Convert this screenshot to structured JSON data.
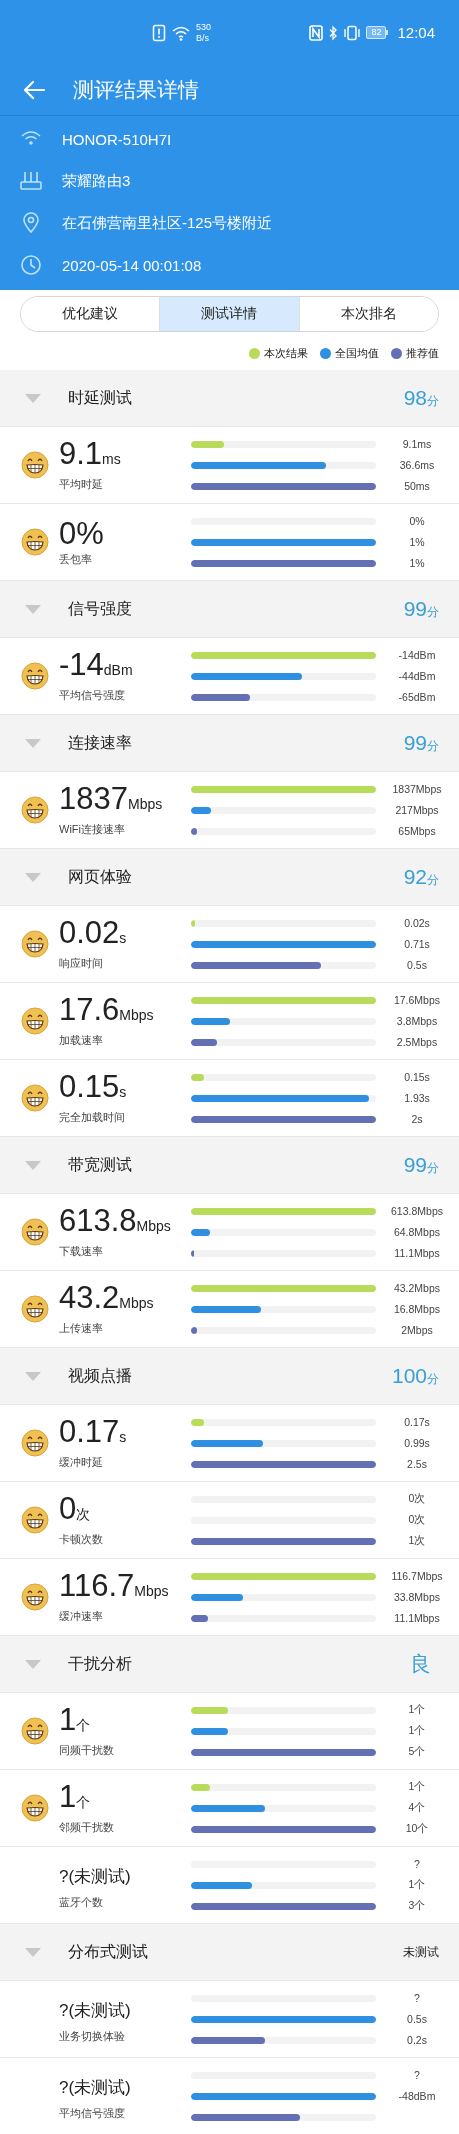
{
  "status_bar": {
    "net_speed": "530",
    "net_unit": "B/s",
    "battery": "82",
    "time": "12:04"
  },
  "title_bar": {
    "title": "测评结果详情"
  },
  "info": [
    {
      "kind": "wifi",
      "text": "HONOR-510H7I"
    },
    {
      "kind": "router",
      "text": "荣耀路由3"
    },
    {
      "kind": "location",
      "text": "在石佛营南里社区-125号楼附近"
    },
    {
      "kind": "time",
      "text": "2020-05-14 00:01:08"
    }
  ],
  "tabs": [
    {
      "label": "优化建议",
      "selected": false
    },
    {
      "label": "测试详情",
      "selected": true
    },
    {
      "label": "本次排名",
      "selected": false
    }
  ],
  "legend": [
    {
      "label": "本次结果",
      "color": "#b8dc5a"
    },
    {
      "label": "全国均值",
      "color": "#2f8fe0"
    },
    {
      "label": "推荐值",
      "color": "#6470b4"
    }
  ],
  "sections": [
    {
      "title": "时延测试",
      "tested": true,
      "score": "98",
      "score_unit": "分",
      "rows": [
        {
          "kind": "measured",
          "value": "9.1",
          "unit": "ms",
          "label": "平均时延",
          "bars": [
            {
              "level": 0.18,
              "reading": "9.1ms"
            },
            {
              "level": 0.73,
              "reading": "36.6ms"
            },
            {
              "level": 1,
              "reading": "50ms"
            }
          ]
        },
        {
          "kind": "measured",
          "value": "0%",
          "label": "丢包率",
          "bars": [
            {
              "reading": "0%"
            },
            {
              "level": 1,
              "reading": "1%"
            },
            {
              "level": 1,
              "reading": "1%"
            }
          ]
        }
      ]
    },
    {
      "title": "信号强度",
      "tested": true,
      "score": "99",
      "score_unit": "分",
      "rows": [
        {
          "kind": "measured",
          "value": "-14",
          "unit": "dBm",
          "label": "平均信号强度",
          "bars": [
            {
              "level": 1,
              "reading": "-14dBm"
            },
            {
              "level": 0.6,
              "reading": "-44dBm"
            },
            {
              "level": 0.32,
              "reading": "-65dBm"
            }
          ]
        }
      ]
    },
    {
      "title": "连接速率",
      "tested": true,
      "score": "99",
      "score_unit": "分",
      "rows": [
        {
          "kind": "measured",
          "value": "1837",
          "unit": "Mbps",
          "label": "WiFi连接速率",
          "bars": [
            {
              "level": 1,
              "reading": "1837Mbps"
            },
            {
              "level": 0.11,
              "reading": "217Mbps"
            },
            {
              "level": 0.03,
              "reading": "65Mbps"
            }
          ]
        }
      ]
    },
    {
      "title": "网页体验",
      "tested": true,
      "score": "92",
      "score_unit": "分",
      "rows": [
        {
          "kind": "measured",
          "value": "0.02",
          "unit": "s",
          "label": "响应时间",
          "bars": [
            {
              "level": 0.02,
              "reading": "0.02s"
            },
            {
              "level": 1,
              "reading": "0.71s"
            },
            {
              "level": 0.7,
              "reading": "0.5s"
            }
          ]
        },
        {
          "kind": "measured",
          "value": "17.6",
          "unit": "Mbps",
          "label": "加载速率",
          "bars": [
            {
              "level": 1,
              "reading": "17.6Mbps"
            },
            {
              "level": 0.21,
              "reading": "3.8Mbps"
            },
            {
              "level": 0.14,
              "reading": "2.5Mbps"
            }
          ]
        },
        {
          "kind": "measured",
          "value": "0.15",
          "unit": "s",
          "label": "完全加载时间",
          "bars": [
            {
              "level": 0.07,
              "reading": "0.15s"
            },
            {
              "level": 0.96,
              "reading": "1.93s"
            },
            {
              "level": 1,
              "reading": "2s"
            }
          ]
        }
      ]
    },
    {
      "title": "带宽测试",
      "tested": true,
      "score": "99",
      "score_unit": "分",
      "rows": [
        {
          "kind": "measured",
          "value": "613.8",
          "unit": "Mbps",
          "label": "下载速率",
          "bars": [
            {
              "level": 1,
              "reading": "613.8Mbps"
            },
            {
              "level": 0.1,
              "reading": "64.8Mbps"
            },
            {
              "level": 0.01,
              "reading": "11.1Mbps"
            }
          ]
        },
        {
          "kind": "measured",
          "value": "43.2",
          "unit": "Mbps",
          "label": "上传速率",
          "bars": [
            {
              "level": 1,
              "reading": "43.2Mbps"
            },
            {
              "level": 0.38,
              "reading": "16.8Mbps"
            },
            {
              "level": 0.03,
              "reading": "2Mbps"
            }
          ]
        }
      ]
    },
    {
      "title": "视频点播",
      "tested": true,
      "score": "100",
      "score_unit": "分",
      "rows": [
        {
          "kind": "measured",
          "value": "0.17",
          "unit": "s",
          "label": "缓冲时延",
          "bars": [
            {
              "level": 0.07,
              "reading": "0.17s"
            },
            {
              "level": 0.39,
              "reading": "0.99s"
            },
            {
              "level": 1,
              "reading": "2.5s"
            }
          ]
        },
        {
          "kind": "measured",
          "value": "0",
          "unit": "次",
          "label": "卡顿次数",
          "bars": [
            {
              "reading": "0次"
            },
            {
              "reading": "0次"
            },
            {
              "level": 1,
              "reading": "1次"
            }
          ]
        },
        {
          "kind": "measured",
          "value": "116.7",
          "unit": "Mbps",
          "label": "缓冲速率",
          "bars": [
            {
              "level": 1,
              "reading": "116.7Mbps"
            },
            {
              "level": 0.28,
              "reading": "33.8Mbps"
            },
            {
              "level": 0.09,
              "reading": "11.1Mbps"
            }
          ]
        }
      ]
    },
    {
      "title": "干扰分析",
      "tested": true,
      "score": "良",
      "rows": [
        {
          "kind": "measured",
          "value": "1",
          "unit": "个",
          "label": "同频干扰数",
          "bars": [
            {
              "level": 0.2,
              "reading": "1个"
            },
            {
              "level": 0.2,
              "reading": "1个"
            },
            {
              "level": 1,
              "reading": "5个"
            }
          ]
        },
        {
          "kind": "measured",
          "value": "1",
          "unit": "个",
          "label": "邻频干扰数",
          "bars": [
            {
              "level": 0.1,
              "reading": "1个"
            },
            {
              "level": 0.4,
              "reading": "4个"
            },
            {
              "level": 1,
              "reading": "10个"
            }
          ]
        },
        {
          "kind": "untested",
          "value": "?(未测试)",
          "label": "蓝牙个数",
          "bars": [
            {
              "reading": "?"
            },
            {
              "level": 0.33,
              "reading": "1个"
            },
            {
              "level": 1,
              "reading": "3个"
            }
          ]
        }
      ]
    },
    {
      "title": "分布式测试",
      "tested": false,
      "score": "未测试",
      "rows": [
        {
          "kind": "untested",
          "value": "?(未测试)",
          "label": "业务切换体验",
          "bars": [
            {
              "reading": "?"
            },
            {
              "level": 1,
              "reading": "0.5s"
            },
            {
              "level": 0.4,
              "reading": "0.2s"
            }
          ]
        },
        {
          "kind": "untested",
          "value": "?(未测试)",
          "label": "平均信号强度",
          "bars": [
            {
              "reading": "?"
            },
            {
              "level": 1,
              "reading": "-48dBm"
            },
            {
              "level": 0.59
            }
          ]
        }
      ]
    }
  ]
}
